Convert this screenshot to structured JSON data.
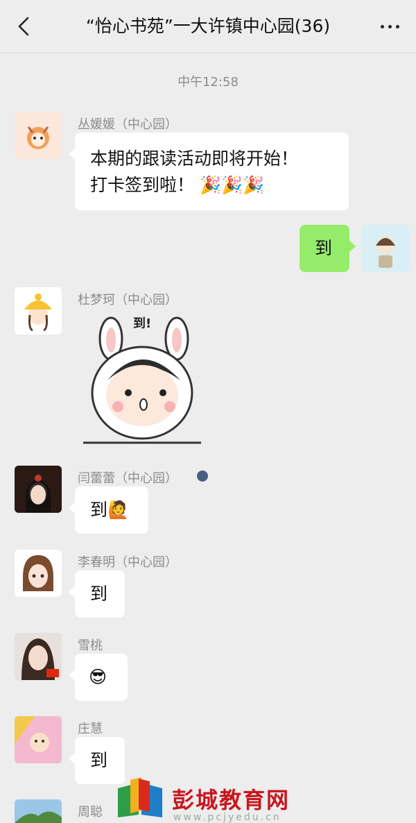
{
  "header": {
    "title": "“怡心书苑”一大许镇中心园(36)"
  },
  "timestamp": "中午12:58",
  "messages": [
    {
      "sender": "丛媛媛（中心园）",
      "lines": [
        "本期的跟读活动即将开始！",
        "打卡签到啦！ 🎉🎉🎉"
      ]
    },
    {
      "self": true,
      "text": "到"
    },
    {
      "sender": "杜梦珂（中心园）",
      "sticker_text": "到!"
    },
    {
      "sender": "闫蕾蕾（中心园）",
      "text": "到🙋"
    },
    {
      "sender": "李春明（中心园）",
      "text": "到"
    },
    {
      "sender": "雪桃",
      "text": "😎"
    },
    {
      "sender": "庄慧",
      "text": "到"
    },
    {
      "sender": "周聪"
    }
  ],
  "watermark": {
    "text": "彭城教育网",
    "url": "www.pcjyedu.cn"
  },
  "colors": {
    "background": "#ededed",
    "self_bubble": "#95ec69",
    "other_bubble": "#ffffff",
    "watermark_red": "#c8161d"
  }
}
